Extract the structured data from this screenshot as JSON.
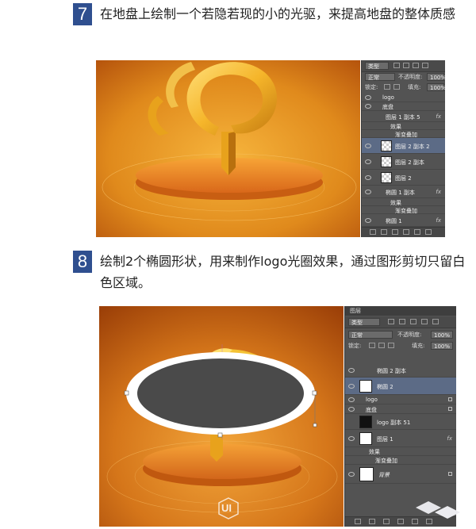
{
  "steps": [
    {
      "number": "7",
      "text": "在地盘上绘制一个若隐若现的小的光驱，来提高地盘的整体质感",
      "layers_panel": {
        "filter_label": "类型",
        "blend_mode": "正常",
        "opacity_label": "不透明度:",
        "opacity_value": "100%",
        "lock_label": "锁定:",
        "fill_label": "填充:",
        "fill_value": "100%",
        "layers": [
          {
            "name": "logo",
            "kind": "group"
          },
          {
            "name": "底盘",
            "kind": "group-open"
          },
          {
            "name": "图层 1 副本 5",
            "kind": "layer",
            "fx": "fx"
          },
          {
            "name": "效果",
            "kind": "effect"
          },
          {
            "name": "渐变叠加",
            "kind": "effect"
          },
          {
            "name": "图层 2 副本 2",
            "kind": "layer",
            "selected": true
          },
          {
            "name": "图层 2 副本",
            "kind": "layer"
          },
          {
            "name": "图层 2",
            "kind": "layer"
          },
          {
            "name": "椭圆 1 副本",
            "kind": "layer",
            "fx": "fx"
          },
          {
            "name": "效果",
            "kind": "effect"
          },
          {
            "name": "渐变叠加",
            "kind": "effect"
          },
          {
            "name": "椭圆 1",
            "kind": "layer",
            "fx": "fx"
          }
        ]
      }
    },
    {
      "number": "8",
      "text": "绘制2个椭圆形状，用来制作logo光圈效果，通过图形剪切只留白色区域。",
      "layers_panel": {
        "tab_label": "图层",
        "filter_label": "类型",
        "blend_mode": "正常",
        "opacity_label": "不透明度:",
        "opacity_value": "100%",
        "lock_label": "锁定:",
        "fill_label": "填充:",
        "fill_value": "100%",
        "layers": [
          {
            "name": "椭圆 2 副本",
            "kind": "layer"
          },
          {
            "name": "椭圆 2",
            "kind": "layer",
            "selected": true
          },
          {
            "name": "logo",
            "kind": "group"
          },
          {
            "name": "底盘",
            "kind": "group"
          },
          {
            "name": "logo 副本 51",
            "kind": "layer"
          },
          {
            "name": "图层 1",
            "kind": "layer",
            "fx": "fx"
          },
          {
            "name": "效果",
            "kind": "effect"
          },
          {
            "name": "渐变叠加",
            "kind": "effect"
          },
          {
            "name": "背景",
            "kind": "layer"
          }
        ]
      },
      "watermark": "UI"
    }
  ],
  "colors": {
    "step_badge": "#2f4f8f",
    "orange_light": "#f2b02a",
    "orange_dark": "#b4500a",
    "panel_bg": "#535353",
    "selected_layer": "#5c6b86"
  }
}
